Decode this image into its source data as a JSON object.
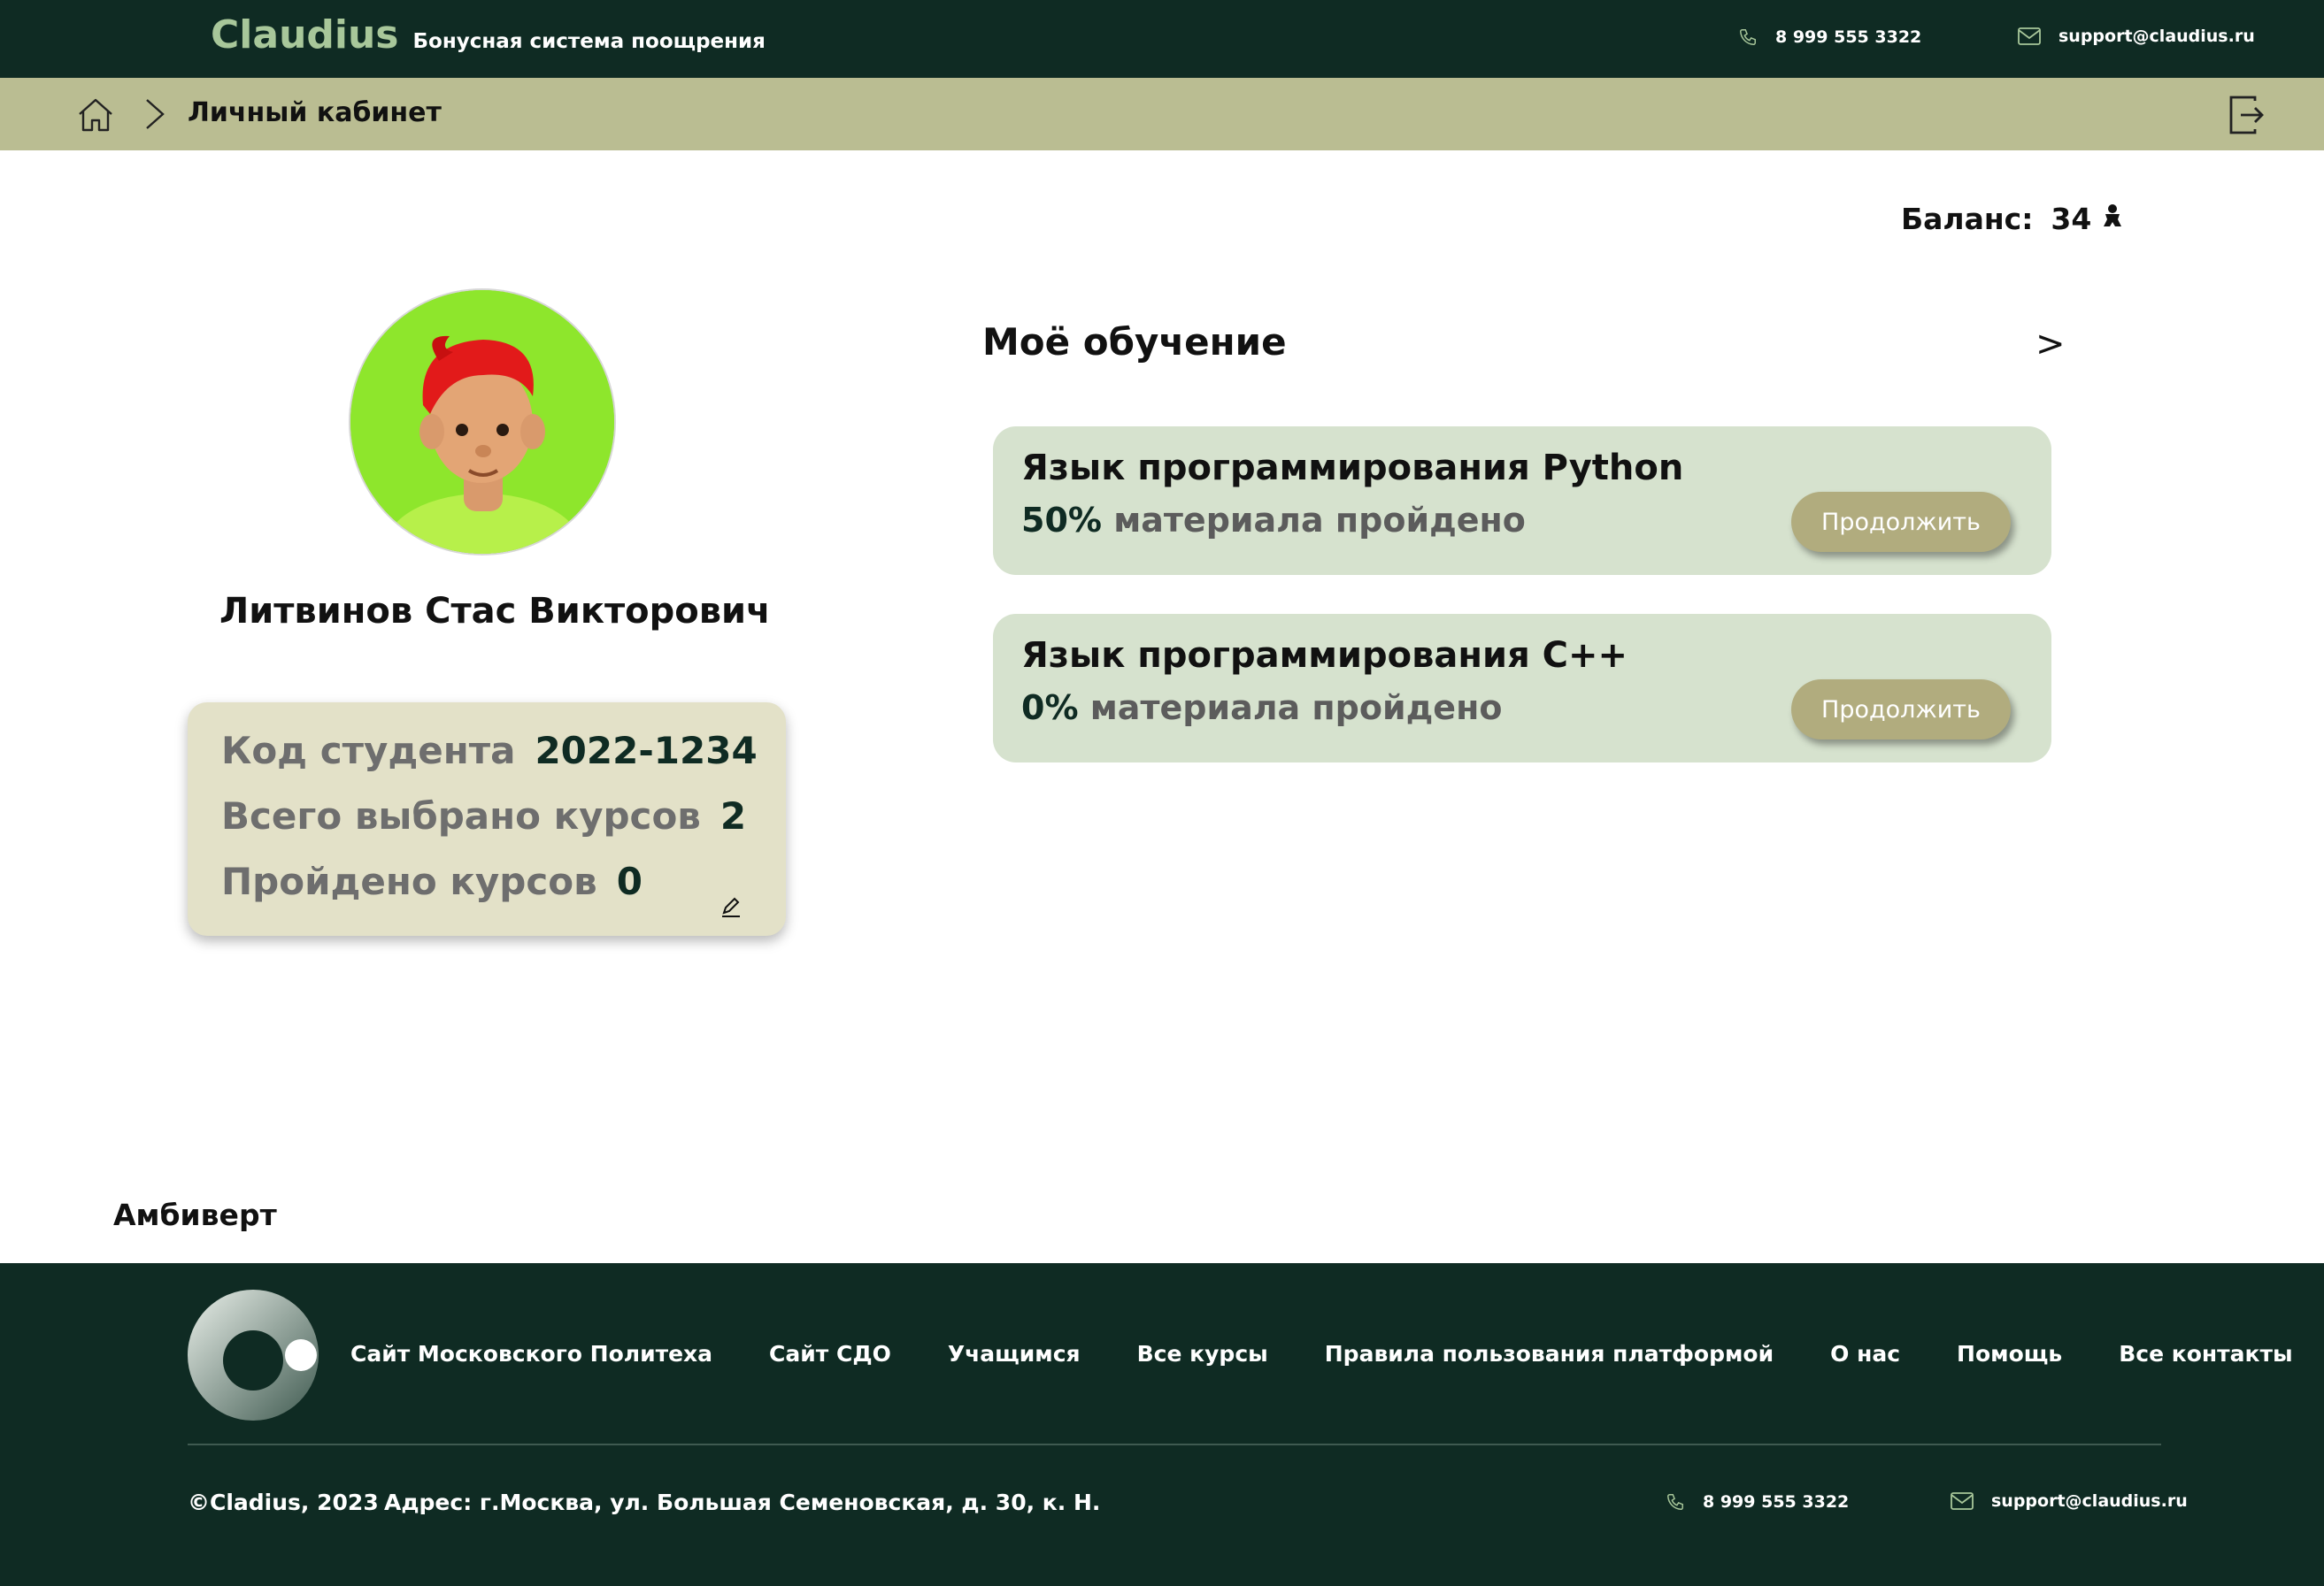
{
  "header": {
    "brand": "Claudius",
    "subtitle": "Бонусная система поощрения",
    "phone": "8 999 555 3322",
    "email": "support@claudius.ru"
  },
  "breadcrumb": {
    "current": "Личный кабинет"
  },
  "balance": {
    "label": "Баланс:",
    "value": "34"
  },
  "profile": {
    "name": "Литвинов Стас Викторович",
    "stats": [
      {
        "label": "Код студента",
        "value": "2022-1234"
      },
      {
        "label": "Всего выбрано курсов",
        "value": "2"
      },
      {
        "label": "Пройдено курсов",
        "value": "0"
      }
    ]
  },
  "learning": {
    "title": "Моё обучение",
    "more": ">",
    "courses": [
      {
        "title": "Язык программирования Python",
        "percent": "50%",
        "progress_text": "материала пройдено",
        "progress": 0.5,
        "button": "Продолжить"
      },
      {
        "title": "Язык программирования C++",
        "percent": "0%",
        "progress_text": "материала пройдено",
        "progress": 0.0,
        "button": "Продолжить"
      }
    ]
  },
  "personality": "Амбиверт",
  "footer": {
    "links": [
      "Сайт Московского Политеха",
      "Сайт СДО",
      "Учащимся",
      "Все курсы",
      "Правила пользования платформой",
      "О нас",
      "Помощь",
      "Все контакты"
    ],
    "copyright": "©Cladius, 2023",
    "address": "Адрес: г.Москва, ул. Большая Семеновская, д. 30, к. Н.",
    "phone": "8 999 555 3322",
    "email": "support@claudius.ru"
  },
  "colors": {
    "header_bg": "#0f2b23",
    "breadcrumb_bg": "#babd92",
    "brand_accent": "#a8c79a",
    "course_card_bg": "#d6e2ce",
    "stats_card_bg": "#e3e1c8",
    "button_bg": "#b1ac7e",
    "avatar_bg": "#8ee62c"
  }
}
